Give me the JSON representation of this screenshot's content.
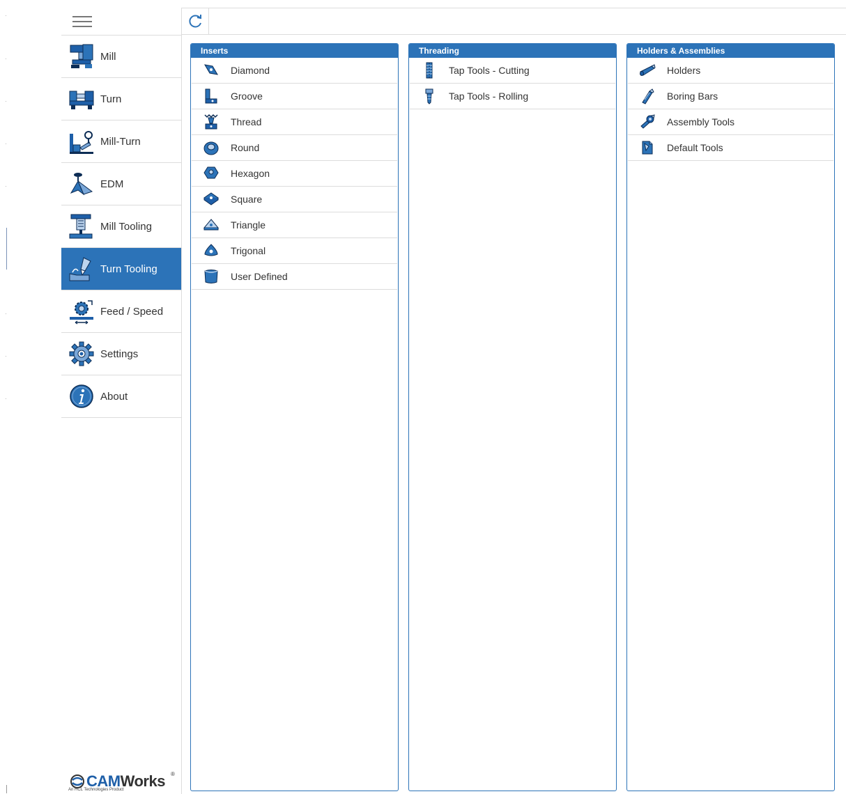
{
  "colors": {
    "accent": "#2c73b8",
    "divider": "#dcdcdc",
    "text": "#333333"
  },
  "sidebar": {
    "items": [
      {
        "label": "Mill",
        "icon": "mill-icon",
        "active": false
      },
      {
        "label": "Turn",
        "icon": "turn-icon",
        "active": false
      },
      {
        "label": "Mill-Turn",
        "icon": "mill-turn-icon",
        "active": false
      },
      {
        "label": "EDM",
        "icon": "edm-icon",
        "active": false
      },
      {
        "label": "Mill Tooling",
        "icon": "mill-tooling-icon",
        "active": false
      },
      {
        "label": "Turn Tooling",
        "icon": "turn-tooling-icon",
        "active": true
      },
      {
        "label": "Feed / Speed",
        "icon": "feed-speed-icon",
        "active": false
      },
      {
        "label": "Settings",
        "icon": "settings-gear-icon",
        "active": false
      },
      {
        "label": "About",
        "icon": "info-icon",
        "active": false
      }
    ],
    "logo": {
      "main": "CAM",
      "suffix": "Works",
      "reg": "®",
      "tagline": "An HCL Technologies Product"
    }
  },
  "panels": [
    {
      "title": "Inserts",
      "items": [
        {
          "label": "Diamond",
          "icon": "diamond-insert-icon"
        },
        {
          "label": "Groove",
          "icon": "groove-insert-icon"
        },
        {
          "label": "Thread",
          "icon": "thread-insert-icon"
        },
        {
          "label": "Round",
          "icon": "round-insert-icon"
        },
        {
          "label": "Hexagon",
          "icon": "hexagon-insert-icon"
        },
        {
          "label": "Square",
          "icon": "square-insert-icon"
        },
        {
          "label": "Triangle",
          "icon": "triangle-insert-icon"
        },
        {
          "label": "Trigonal",
          "icon": "trigonal-insert-icon"
        },
        {
          "label": "User Defined",
          "icon": "user-defined-insert-icon"
        }
      ]
    },
    {
      "title": "Threading",
      "items": [
        {
          "label": "Tap Tools - Cutting",
          "icon": "tap-cutting-icon"
        },
        {
          "label": "Tap Tools - Rolling",
          "icon": "tap-rolling-icon"
        }
      ]
    },
    {
      "title": "Holders & Assemblies",
      "items": [
        {
          "label": "Holders",
          "icon": "holder-icon"
        },
        {
          "label": "Boring Bars",
          "icon": "boring-bar-icon"
        },
        {
          "label": "Assembly Tools",
          "icon": "assembly-tools-icon"
        },
        {
          "label": "Default Tools",
          "icon": "default-tools-icon"
        }
      ]
    }
  ]
}
